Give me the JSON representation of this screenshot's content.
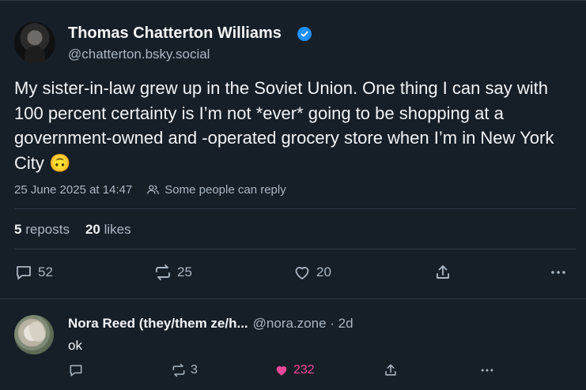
{
  "post": {
    "author_name": "Thomas Chatterton Williams",
    "author_handle": "@chatterton.bsky.social",
    "text": "My sister-in-law grew up in the Soviet Union. One thing I can say with 100 percent certainty is I’m not *ever* going to be shopping at a government-owned and -operated grocery store when I’m in New York City 🙃",
    "timestamp": "25 June 2025 at 14:47",
    "reply_setting": "Some people can reply",
    "stats": {
      "reposts_count": "5",
      "reposts_label": "reposts",
      "likes_count": "20",
      "likes_label": "likes"
    },
    "actions": {
      "replies": "52",
      "reposts": "25",
      "likes": "20"
    }
  },
  "reply": {
    "author_name": "Nora Reed (they/them ze/h...",
    "author_handle": "@nora.zone · 2d",
    "text": "ok",
    "actions": {
      "replies": "",
      "reposts": "3",
      "likes": "232"
    }
  },
  "colors": {
    "background": "#161e27",
    "verified": "#1e8fff",
    "like": "#ec4899",
    "muted": "#aab7c4"
  }
}
